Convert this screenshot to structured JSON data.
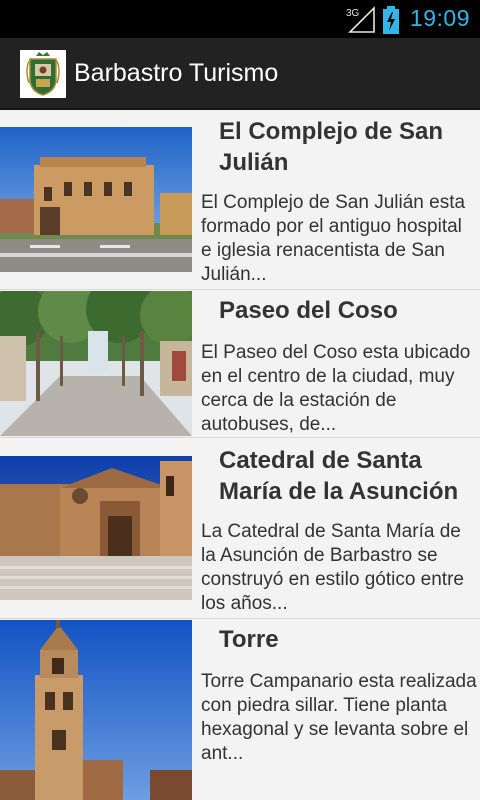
{
  "status_bar": {
    "network": "3G",
    "time": "19:09",
    "accent": "#33b5e5"
  },
  "app": {
    "title": "Barbastro Turismo",
    "icon": "barbastro-coat-of-arms-icon"
  },
  "items": [
    {
      "title": "El Complejo de San Julián",
      "description": "El Complejo de San Julián esta formado por el antiguo hospital e iglesia renacentista de San Julián...",
      "image": "complejo-san-julian-photo"
    },
    {
      "title": "Paseo del Coso",
      "description": "El Paseo del Coso esta ubicado en el centro de la ciudad, muy cerca de la estación de autobuses, de...",
      "image": "paseo-del-coso-photo"
    },
    {
      "title": "Catedral de Santa María de la Asunción",
      "description": "La Catedral de Santa María de la Asunción de Barbastro se construyó en estilo gótico entre los años...",
      "image": "catedral-santa-maria-photo"
    },
    {
      "title": "Torre",
      "description": "Torre Campanario esta realizada con piedra sillar. Tiene planta hexagonal y se levanta sobre el ant...",
      "image": "torre-campanario-photo"
    }
  ]
}
